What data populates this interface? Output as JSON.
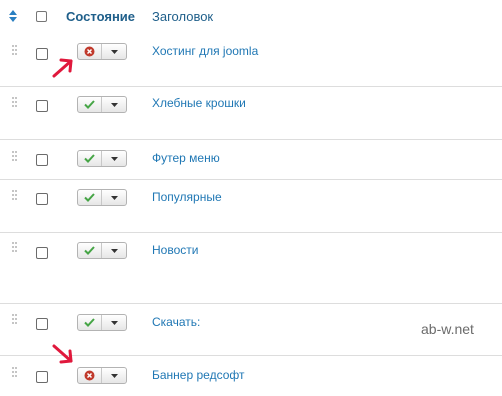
{
  "header": {
    "sort_icon": "sort-arrows-icon",
    "state_label": "Состояние",
    "title_label": "Заголовок"
  },
  "rows": [
    {
      "title": "Хостинг для joomla",
      "state": "unpublished",
      "state_icon": "unpublished-x-icon"
    },
    {
      "title": "Хлебные крошки",
      "state": "published",
      "state_icon": "published-check-icon"
    },
    {
      "title": "Футер меню",
      "state": "published",
      "state_icon": "published-check-icon"
    },
    {
      "title": "Популярные",
      "state": "published",
      "state_icon": "published-check-icon"
    },
    {
      "title": "Новости",
      "state": "published",
      "state_icon": "published-check-icon"
    },
    {
      "title": "Скачать:",
      "state": "published",
      "state_icon": "published-check-icon"
    },
    {
      "title": "Баннер редсофт",
      "state": "unpublished",
      "state_icon": "unpublished-x-icon"
    }
  ],
  "watermark": "ab-w.net",
  "colors": {
    "link": "#1f77b4",
    "header_text": "#1f5f8a",
    "published_green": "#46a546",
    "unpublished_red": "#c0392b",
    "annotation_arrow": "#e0183c"
  }
}
